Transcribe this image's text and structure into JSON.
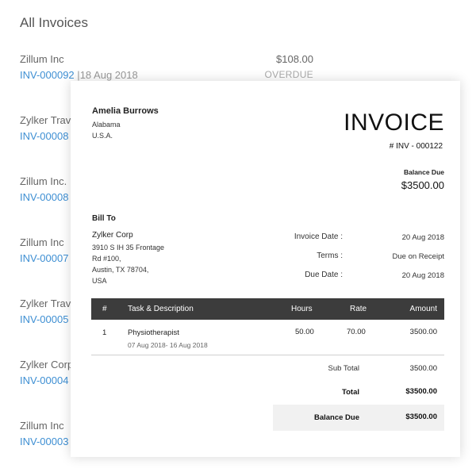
{
  "list": {
    "title": "All Invoices",
    "items": [
      {
        "customer": "Zillum Inc",
        "number": "INV-000092",
        "separator": "|",
        "date": "18 Aug 2018",
        "amount": "$108.00",
        "status": "OVERDUE"
      },
      {
        "customer": "Zylker Trav",
        "number": "INV-00008"
      },
      {
        "customer": "Zillum Inc.",
        "number": "INV-00008"
      },
      {
        "customer": "Zillum Inc",
        "number": "INV-00007"
      },
      {
        "customer": "Zylker Trav",
        "number": "INV-00005"
      },
      {
        "customer": "Zylker Corp",
        "number": "INV-00004"
      },
      {
        "customer": "Zillum Inc",
        "number": "INV-00003"
      }
    ]
  },
  "invoice": {
    "from": {
      "name": "Amelia Burrows",
      "lines": [
        "Alabama",
        "U.S.A."
      ]
    },
    "title": "INVOICE",
    "number": "# INV - 000122",
    "balance_due_label": "Balance Due",
    "balance_due_value": "$3500.00",
    "bill_to": {
      "label": "Bill To",
      "name": "Zylker Corp",
      "lines": [
        "3910 S IH 35 Frontage",
        "Rd #100,",
        "Austin, TX 78704,",
        "USA"
      ]
    },
    "meta": [
      {
        "label": "Invoice Date :",
        "value": "20 Aug 2018"
      },
      {
        "label": "Terms :",
        "value": "Due on Receipt"
      },
      {
        "label": "Due Date :",
        "value": "20 Aug 2018"
      }
    ],
    "table": {
      "headers": {
        "num": "#",
        "desc": "Task & Description",
        "hours": "Hours",
        "rate": "Rate",
        "amount": "Amount"
      },
      "rows": [
        {
          "num": "1",
          "desc": "Physiotherapist",
          "sub": "07 Aug 2018- 16 Aug 2018",
          "hours": "50.00",
          "rate": "70.00",
          "amount": "3500.00"
        }
      ]
    },
    "totals": {
      "subtotal_label": "Sub Total",
      "subtotal_value": "3500.00",
      "total_label": "Total",
      "total_value": "$3500.00",
      "balance_label": "Balance Due",
      "balance_value": "$3500.00"
    }
  },
  "colors": {
    "link": "#3e8fd3",
    "table_header": "#3c3c3c",
    "balance_box": "#f1f1f1"
  }
}
